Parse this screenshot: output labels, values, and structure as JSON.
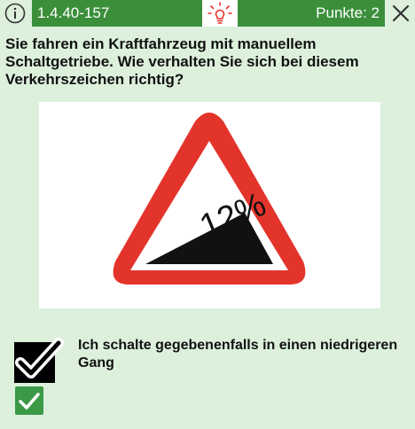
{
  "header": {
    "question_id": "1.4.40-157",
    "points_label": "Punkte: 2",
    "info_icon": "info-icon",
    "hint_icon": "lightbulb-icon",
    "close_icon": "close-icon",
    "accent_color": "#3b8f3b",
    "hint_color": "#e8322b"
  },
  "question": {
    "text": "Sie fahren ein Kraftfahrzeug mit manuellem Schaltgetriebe. Wie verhalten Sie sich bei diesem Verkehrszeichen richtig?"
  },
  "sign": {
    "grade_label": "12%",
    "border_color": "#e3342b"
  },
  "answers": [
    {
      "text": "Ich schalte gegebenenfalls in einen niedrigeren Gang",
      "checked": true,
      "correct": true
    }
  ],
  "colors": {
    "background": "#dcf0dc",
    "correct_mark": "#3a9a46"
  }
}
